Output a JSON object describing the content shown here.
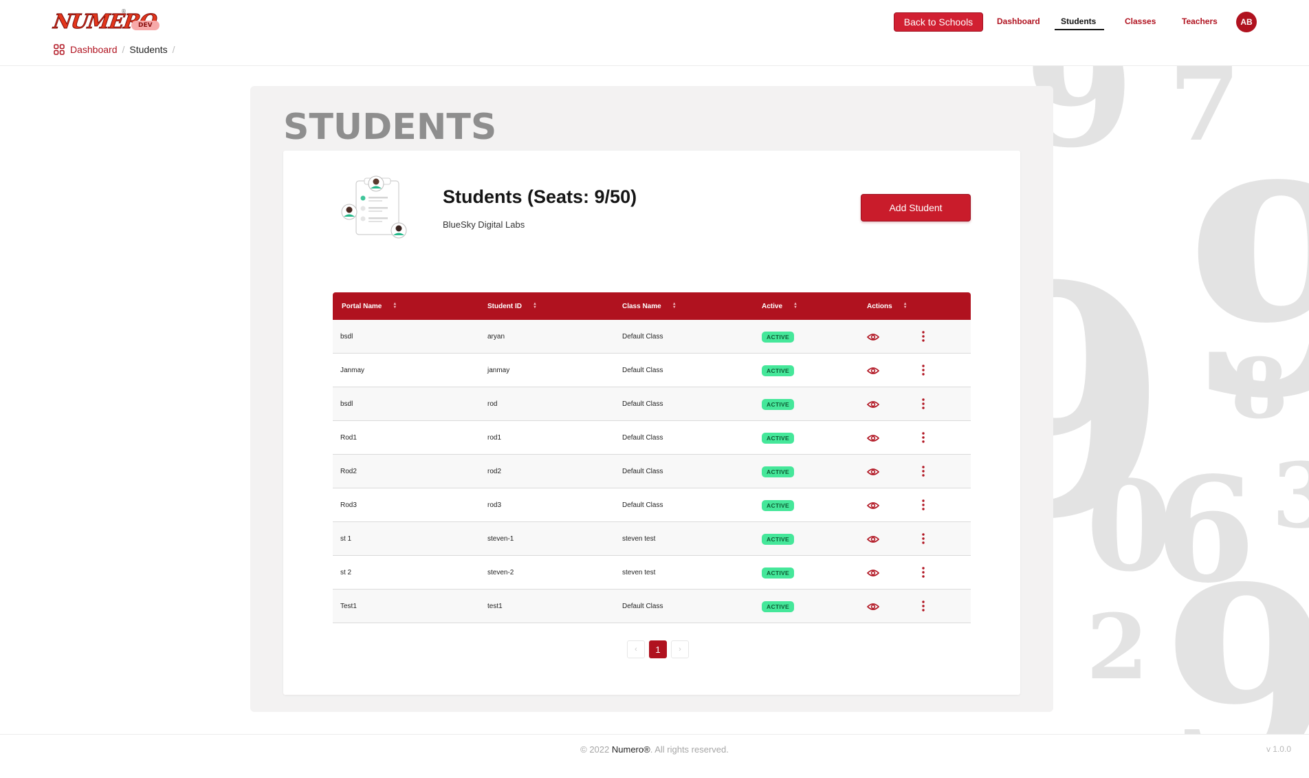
{
  "app": {
    "logo_text": "NUMERO",
    "logo_reg": "®",
    "env_badge": "DEV"
  },
  "nav": {
    "back_label": "Back to Schools",
    "links": [
      "Dashboard",
      "Students",
      "Classes",
      "Teachers"
    ],
    "active": "Students",
    "avatar_initials": "AB"
  },
  "breadcrumb": {
    "items": [
      "Dashboard",
      "Students"
    ],
    "separator": "/"
  },
  "page": {
    "title": "STUDENTS",
    "heading": "Students (Seats: 9/50)",
    "school": "BlueSky Digital Labs",
    "add_label": "Add Student"
  },
  "table": {
    "columns": [
      "Portal Name",
      "Student ID",
      "Class Name",
      "Active",
      "Actions"
    ],
    "rows": [
      {
        "portal_name": "bsdl",
        "student_id": "aryan",
        "class_name": "Default Class",
        "active": "ACTIVE"
      },
      {
        "portal_name": "Janmay",
        "student_id": "janmay",
        "class_name": "Default Class",
        "active": "ACTIVE"
      },
      {
        "portal_name": "bsdl",
        "student_id": "rod",
        "class_name": "Default Class",
        "active": "ACTIVE"
      },
      {
        "portal_name": "Rod1",
        "student_id": "rod1",
        "class_name": "Default Class",
        "active": "ACTIVE"
      },
      {
        "portal_name": "Rod2",
        "student_id": "rod2",
        "class_name": "Default Class",
        "active": "ACTIVE"
      },
      {
        "portal_name": "Rod3",
        "student_id": "rod3",
        "class_name": "Default Class",
        "active": "ACTIVE"
      },
      {
        "portal_name": "st 1",
        "student_id": "steven-1",
        "class_name": "steven test",
        "active": "ACTIVE"
      },
      {
        "portal_name": "st 2",
        "student_id": "steven-2",
        "class_name": "steven test",
        "active": "ACTIVE"
      },
      {
        "portal_name": "Test1",
        "student_id": "test1",
        "class_name": "Default Class",
        "active": "ACTIVE"
      }
    ]
  },
  "pagination": {
    "prev": "‹",
    "current": "1",
    "next": "›"
  },
  "footer": {
    "copy_prefix": "© 2022 ",
    "brand": "Numero®",
    "copy_suffix": ". All rights reserved.",
    "version": "v 1.0.0"
  },
  "colors": {
    "brand_red": "#b0121f",
    "button_red": "#c91c2b",
    "active_green": "#45e79a"
  },
  "icons": [
    "dashboard-grid-icon",
    "sort-icon",
    "eye-icon",
    "more-vertical-icon"
  ]
}
